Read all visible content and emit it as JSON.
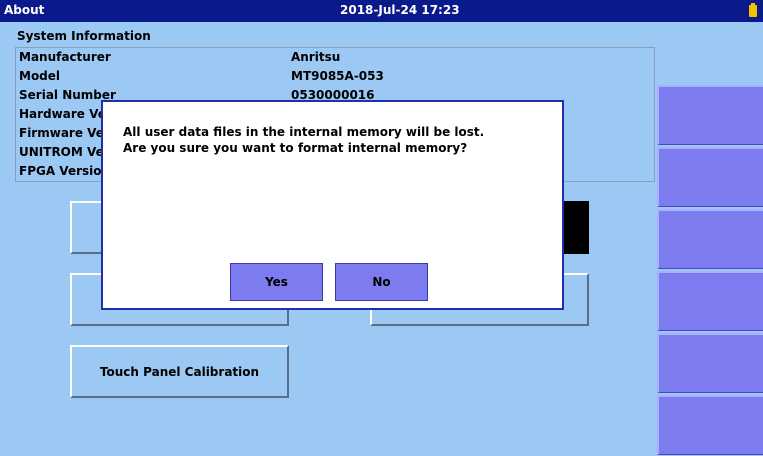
{
  "window": {
    "title": "About",
    "datetime": "2018-Jul-24 17:23",
    "battery_icon": "battery-icon"
  },
  "system_info": {
    "heading": "System Information",
    "rows": [
      {
        "label": "Manufacturer",
        "value": "Anritsu"
      },
      {
        "label": "Model",
        "value": "MT9085A-053"
      },
      {
        "label": "Serial Number",
        "value": "0530000016"
      },
      {
        "label": "Hardware Ver",
        "value": ""
      },
      {
        "label": "Firmware Ver",
        "value": ""
      },
      {
        "label": "UNITROM Ver",
        "value": ""
      },
      {
        "label": "FPGA Version",
        "value": ""
      }
    ]
  },
  "buttons": {
    "touch_panel_calibration": "Touch Panel Calibration"
  },
  "dialog": {
    "line1": "All user data files in the internal memory will be lost.",
    "line2": "Are you sure you want to format internal memory?",
    "yes_label": "Yes",
    "no_label": "No"
  },
  "colors": {
    "title_bar": "#0a1a8a",
    "background": "#9cc8f4",
    "softkey": "#7c7cf0",
    "dialog_border": "#1f2fb0"
  }
}
